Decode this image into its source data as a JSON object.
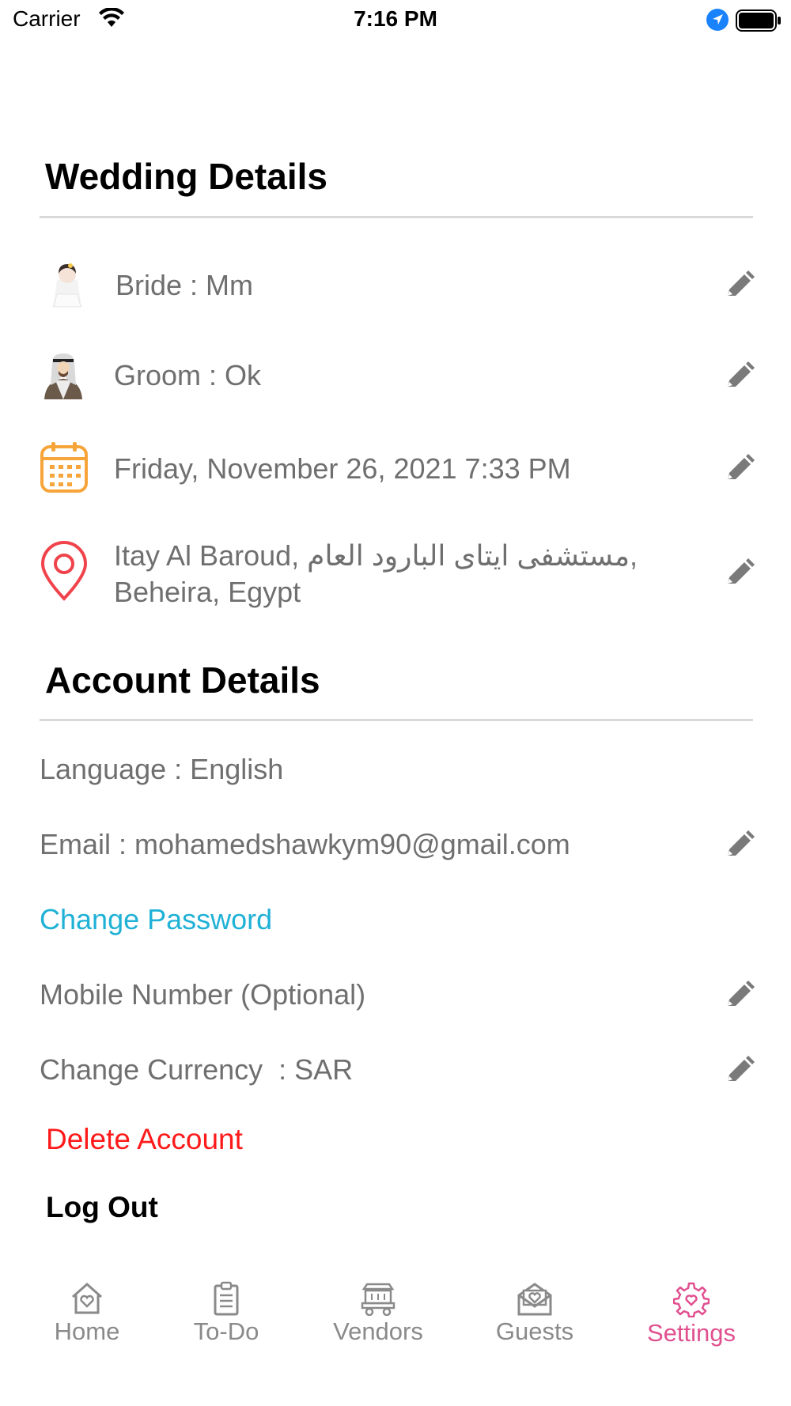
{
  "status_bar": {
    "carrier": "Carrier",
    "time": "7:16 PM"
  },
  "wedding": {
    "title": "Wedding Details",
    "bride": "Bride : Mm",
    "groom": "Groom : Ok",
    "date": "Friday, November 26, 2021 7:33 PM",
    "location_line1": "Itay Al Baroud, مستشفى ايتاى البارود العام,",
    "location_line2": "Beheira, Egypt"
  },
  "account": {
    "title": "Account Details",
    "language": "Language : English",
    "email": "Email : mohamedshawkym90@gmail.com",
    "change_password": "Change Password",
    "mobile": "Mobile Number (Optional)",
    "currency": "Change Currency  : SAR",
    "delete": "Delete Account",
    "logout": "Log Out"
  },
  "tabs": [
    {
      "label": "Home",
      "icon": "home-heart-icon"
    },
    {
      "label": "To-Do",
      "icon": "clipboard-icon"
    },
    {
      "label": "Vendors",
      "icon": "vendor-cart-icon"
    },
    {
      "label": "Guests",
      "icon": "envelope-heart-icon"
    },
    {
      "label": "Settings",
      "icon": "gear-icon",
      "active": true
    }
  ],
  "colors": {
    "accent_pink": "#e0508f",
    "link_blue": "#1fb1d6",
    "danger_red": "#ff1a1a",
    "calendar_orange": "#f7a53a",
    "location_red": "#f0434b"
  }
}
